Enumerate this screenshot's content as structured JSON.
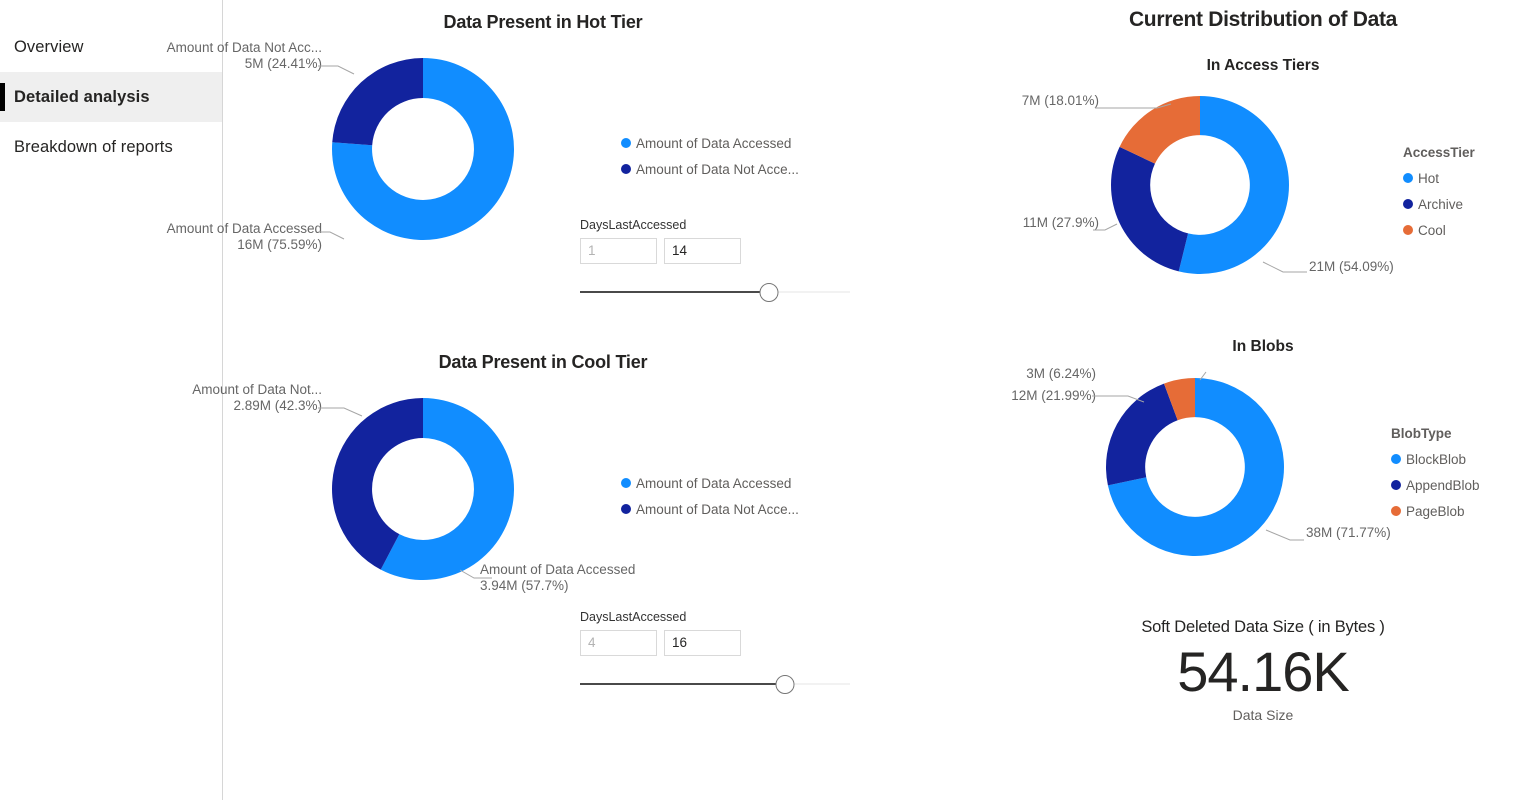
{
  "sidebar": {
    "items": [
      {
        "label": "Overview",
        "selected": false
      },
      {
        "label": "Detailed analysis",
        "selected": true
      },
      {
        "label": "Breakdown of reports",
        "selected": false
      }
    ]
  },
  "colors": {
    "blue": "#118DFF",
    "navy": "#12239E",
    "orange": "#E66C37",
    "label": "#666666",
    "leader": "#A6A6A6",
    "accent": "#000000",
    "selected_bg": "#EFEFEF"
  },
  "left_panel": {
    "hot": {
      "title": "Data Present in Hot Tier",
      "legend": [
        {
          "label": "Amount of Data Accessed",
          "color": "#118DFF"
        },
        {
          "label": "Amount of Data Not Acce...",
          "color": "#12239E"
        }
      ],
      "slicer": {
        "label": "DaysLastAccessed",
        "min_value": "1",
        "max_value": "14",
        "handle_percent": 70
      }
    },
    "cool": {
      "title": "Data Present in Cool Tier",
      "legend": [
        {
          "label": "Amount of Data Accessed",
          "color": "#118DFF"
        },
        {
          "label": "Amount of Data Not Acce...",
          "color": "#12239E"
        }
      ],
      "slicer": {
        "label": "DaysLastAccessed",
        "min_value": "4",
        "max_value": "16",
        "handle_percent": 76
      }
    }
  },
  "right_panel": {
    "title": "Current Distribution of Data",
    "access_tiers": {
      "subtitle": "In Access Tiers",
      "legend_title": "AccessTier",
      "legend": [
        {
          "label": "Hot",
          "color": "#118DFF"
        },
        {
          "label": "Archive",
          "color": "#12239E"
        },
        {
          "label": "Cool",
          "color": "#E66C37"
        }
      ]
    },
    "blobs": {
      "subtitle": "In Blobs",
      "legend_title": "BlobType",
      "legend": [
        {
          "label": "BlockBlob",
          "color": "#118DFF"
        },
        {
          "label": "AppendBlob",
          "color": "#12239E"
        },
        {
          "label": "PageBlob",
          "color": "#E66C37"
        }
      ]
    },
    "card": {
      "title": "Soft Deleted Data Size ( in Bytes )",
      "value": "54.16K",
      "caption": "Data Size"
    }
  },
  "chart_data": [
    {
      "id": "hot_tier",
      "type": "pie",
      "variant": "donut",
      "title": "Data Present in Hot Tier",
      "hole_ratio": 0.56,
      "start_angle": 0,
      "legend_position": "right",
      "labels": [
        "Amount of Data Accessed",
        "Amount of Data Not Acc..."
      ],
      "values": [
        16,
        5
      ],
      "value_labels": [
        "16M",
        "5M"
      ],
      "percents": [
        75.59,
        24.41
      ],
      "percent_labels": [
        "(75.59%)",
        "(24.41%)"
      ],
      "colors": [
        "#118DFF",
        "#12239E"
      ],
      "unit": "M"
    },
    {
      "id": "cool_tier",
      "type": "pie",
      "variant": "donut",
      "title": "Data Present in Cool Tier",
      "hole_ratio": 0.56,
      "start_angle": 0,
      "legend_position": "right",
      "labels": [
        "Amount of Data Accessed",
        "Amount of Data Not..."
      ],
      "values": [
        3.94,
        2.89
      ],
      "value_labels": [
        "3.94M",
        "2.89M"
      ],
      "percents": [
        57.7,
        42.3
      ],
      "percent_labels": [
        "(57.7%)",
        "(42.3%)"
      ],
      "colors": [
        "#118DFF",
        "#12239E"
      ],
      "unit": "M"
    },
    {
      "id": "access_tiers",
      "type": "pie",
      "variant": "donut",
      "title": "In Access Tiers",
      "hole_ratio": 0.56,
      "start_angle": 0,
      "legend_position": "right",
      "legend_title": "AccessTier",
      "labels": [
        "Hot",
        "Archive",
        "Cool"
      ],
      "values": [
        21,
        11,
        7
      ],
      "value_labels": [
        "21M",
        "11M",
        "7M"
      ],
      "percents": [
        54.09,
        27.9,
        18.01
      ],
      "percent_labels": [
        "(54.09%)",
        "(27.9%)",
        "(18.01%)"
      ],
      "colors": [
        "#118DFF",
        "#12239E",
        "#E66C37"
      ],
      "unit": "M"
    },
    {
      "id": "blobs",
      "type": "pie",
      "variant": "donut",
      "title": "In Blobs",
      "hole_ratio": 0.56,
      "start_angle": 0,
      "legend_position": "right",
      "legend_title": "BlobType",
      "labels": [
        "BlockBlob",
        "AppendBlob",
        "PageBlob"
      ],
      "values": [
        38,
        12,
        3
      ],
      "value_labels": [
        "38M",
        "12M",
        "3M"
      ],
      "percents": [
        71.77,
        21.99,
        6.24
      ],
      "percent_labels": [
        "(71.77%)",
        "(21.99%)",
        "(6.24%)"
      ],
      "colors": [
        "#118DFF",
        "#12239E",
        "#E66C37"
      ],
      "unit": "M"
    },
    {
      "id": "soft_deleted_card",
      "type": "table",
      "title": "Soft Deleted Data Size ( in Bytes )",
      "categories": [
        "Data Size"
      ],
      "values": [
        "54.16K"
      ]
    }
  ]
}
